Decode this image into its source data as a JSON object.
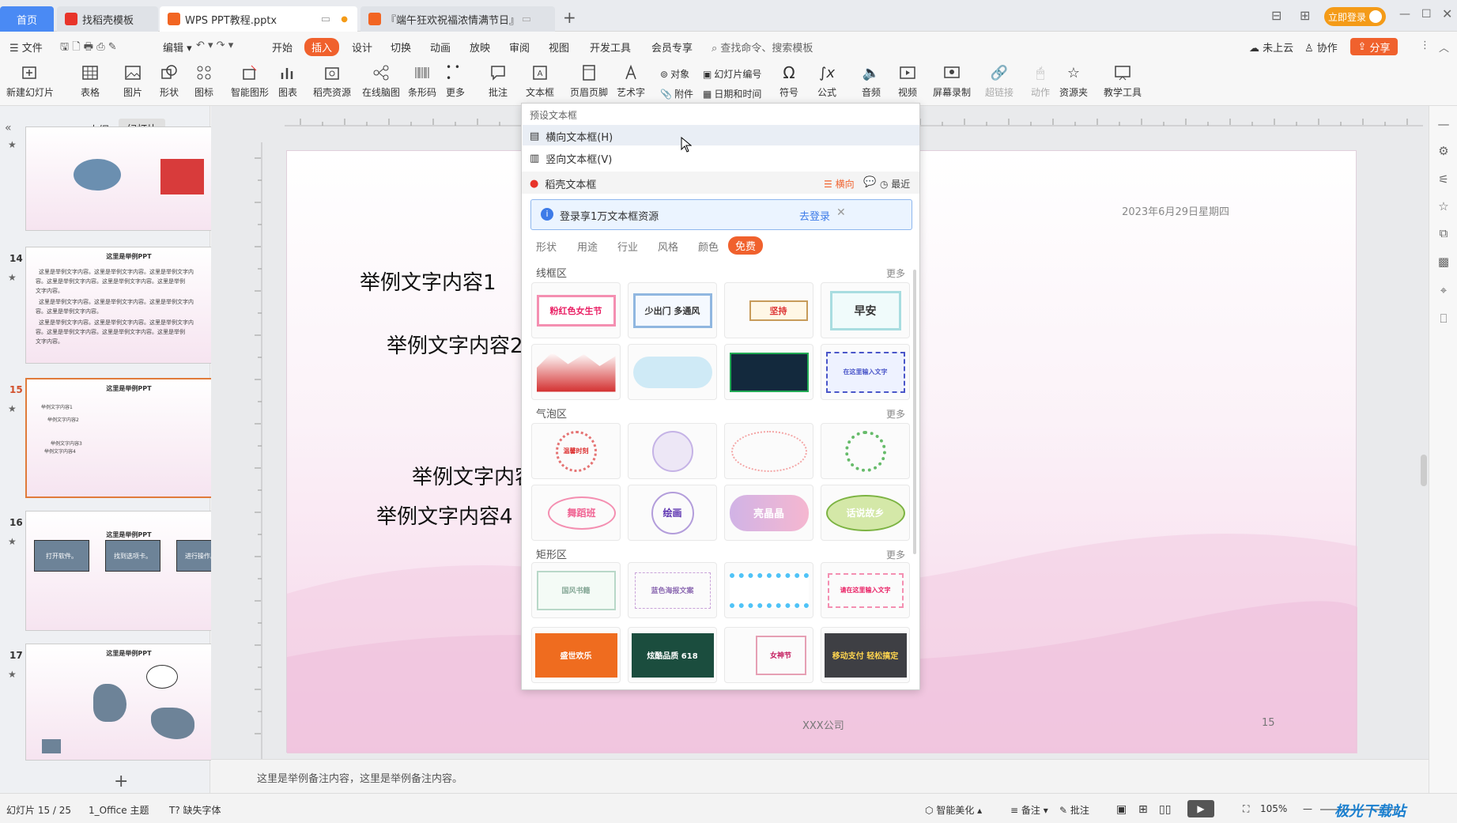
{
  "tabs": {
    "home": "首页",
    "templates": "找稻壳模板",
    "doc": "WPS PPT教程.pptx",
    "fest": "『端午狂欢祝福浓情满节日』"
  },
  "window": {
    "login": "立即登录"
  },
  "menu": {
    "file": "文件",
    "edit": "编辑",
    "start": "开始",
    "insert": "插入",
    "design": "设计",
    "transition": "切换",
    "animation": "动画",
    "show": "放映",
    "review": "审阅",
    "view": "视图",
    "dev": "开发工具",
    "member": "会员专享",
    "search": "查找命令、搜索模板",
    "cloud": "未上云",
    "collab": "协作",
    "share": "分享"
  },
  "ribbon": {
    "new_slide": "新建幻灯片",
    "table": "表格",
    "picture": "图片",
    "shape": "形状",
    "icon": "图标",
    "smart": "智能图形",
    "chart": "图表",
    "daoke": "稻壳资源",
    "online_chart": "在线脑图",
    "barcode": "条形码",
    "more": "更多",
    "comment": "批注",
    "textbox": "文本框",
    "header_footer": "页眉页脚",
    "wordart": "艺术字",
    "object": "对象",
    "slide_num": "幻灯片编号",
    "attach": "附件",
    "datetime": "日期和时间",
    "symbol": "符号",
    "formula": "公式",
    "audio": "音频",
    "video": "视频",
    "screen_rec": "屏幕录制",
    "hyperlink": "超链接",
    "action": "动作",
    "resources": "资源夹",
    "teach": "教学工具"
  },
  "panel": {
    "outline": "大纲",
    "slides": "幻灯片"
  },
  "thumbs": [
    {
      "num": "",
      "title": ""
    },
    {
      "num": "14",
      "title": "这里是举例PPT",
      "lines": [
        "这里是举例文字内容。这里是举例文字内容。这里是举例文字内",
        "容。这里是举例文字内容。这里是举例文字内容。这里是举例",
        "文字内容。",
        "这里是举例文字内容。这里是举例文字内容。这里是举例文字内",
        "容。这里是举例文字内容。",
        "这里是举例文字内容。这里是举例文字内容。这里是举例文字内",
        "容。这里是举例文字内容。这里是举例文字内容。这里是举例",
        "文字内容。"
      ]
    },
    {
      "num": "15",
      "title": "这里是举例PPT",
      "lines": [
        "举例文字内容1",
        "举例文字内容2",
        "举例文字内容3",
        "举例文字内容4"
      ]
    },
    {
      "num": "16",
      "title": "这里是举例PPT",
      "boxes": [
        "打开软件。",
        "找到选项卡。",
        "进行操作。"
      ]
    },
    {
      "num": "17",
      "title": "这里是举例PPT"
    }
  ],
  "slide": {
    "date": "2023年6月29日星期四",
    "t1": "举例文字内容1",
    "t2": "举例文字内容2",
    "t3": "举例文字内容3",
    "t4": "举例文字内容4",
    "company": "XXX公司",
    "page": "15"
  },
  "dropdown": {
    "preset": "预设文本框",
    "horizontal": "横向文本框(H)",
    "vertical": "竖向文本框(V)",
    "daoke": "稻壳文本框",
    "opt_h": "横向",
    "recent": "最近",
    "banner": "登录享1万文本框资源",
    "banner_action": "去登录",
    "filters": [
      "形状",
      "用途",
      "行业",
      "风格",
      "颜色",
      "免费"
    ],
    "sections": [
      {
        "name": "线框区",
        "more": "更多"
      },
      {
        "name": "气泡区",
        "more": "更多"
      },
      {
        "name": "矩形区",
        "more": "更多"
      }
    ],
    "cards": [
      [
        "粉红色女生节",
        "少出门 多通风",
        "坚持",
        "早安"
      ],
      [
        "",
        "",
        "",
        "在这里输入文字"
      ],
      [
        "温馨时刻",
        "",
        "",
        "",
        ""
      ],
      [
        "舞蹈班",
        "绘画",
        "亮晶晶",
        "话说故乡"
      ],
      [
        "国风书籍",
        "蓝色海报文案",
        "",
        "请在这里输入文字"
      ],
      [
        "盛世欢乐",
        "炫酷品质 618",
        "女神节",
        "移动支付 轻松搞定"
      ]
    ]
  },
  "notes": "这里是举例备注内容，这里是举例备注内容。",
  "status": {
    "slide": "幻灯片 15 / 25",
    "theme": "1_Office 主题",
    "font": "缺失字体",
    "beautify": "智能美化",
    "notes": "备注",
    "comment": "批注",
    "zoom": "105%",
    "watermark": "极光下载站"
  }
}
